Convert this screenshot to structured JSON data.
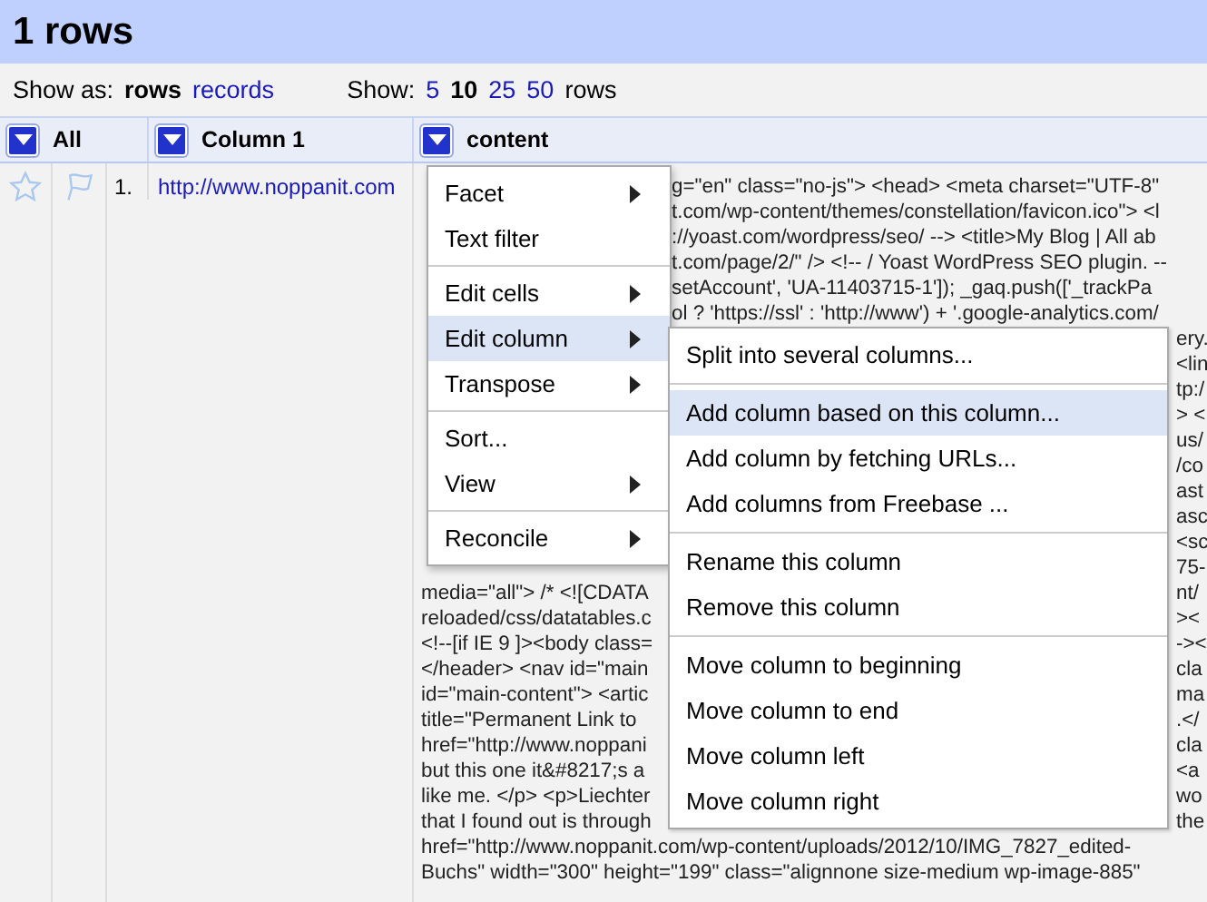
{
  "title": "1 rows",
  "toolbar": {
    "show_as_label": "Show as:",
    "show_as": [
      {
        "label": "rows",
        "selected": true
      },
      {
        "label": "records",
        "selected": false
      }
    ],
    "show_label": "Show:",
    "page_sizes": [
      {
        "label": "5",
        "selected": false
      },
      {
        "label": "10",
        "selected": true
      },
      {
        "label": "25",
        "selected": false
      },
      {
        "label": "50",
        "selected": false
      }
    ],
    "page_sizes_suffix": "rows"
  },
  "columns": [
    {
      "label": "All"
    },
    {
      "label": "Column 1"
    },
    {
      "label": "content"
    }
  ],
  "row": {
    "index": "1.",
    "starred": false,
    "flagged": false,
    "url": "http://www.noppanit.com"
  },
  "content_lines": [
    {
      "kind": "beside_menu",
      "right": "g=\"en\" class=\"no-js\"> <head> <meta charset=\"UTF-8\""
    },
    {
      "kind": "beside_menu",
      "right": "t.com/wp-content/themes/constellation/favicon.ico\"> <l"
    },
    {
      "kind": "beside_menu",
      "right": "://yoast.com/wordpress/seo/ --> <title>My Blog | All ab"
    },
    {
      "kind": "beside_menu",
      "right": "t.com/page/2/\" /> <!-- / Yoast WordPress SEO plugin. --"
    },
    {
      "kind": "beside_menu",
      "right": "setAccount', 'UA-11403715-1']); _gaq.push(['_trackPa"
    },
    {
      "kind": "beside_menu",
      "right": "ol ? 'https://ssl' : 'http://www') + '.google-analytics.com/"
    },
    {
      "kind": "beside_submenu",
      "right": "ery."
    },
    {
      "kind": "beside_submenu",
      "right": "<lin"
    },
    {
      "kind": "beside_submenu",
      "right": "tp:/"
    },
    {
      "kind": "beside_submenu",
      "right": "> <"
    },
    {
      "kind": "beside_submenu",
      "right": "us/"
    },
    {
      "kind": "beside_submenu",
      "right": "/co"
    },
    {
      "kind": "beside_submenu",
      "right": "ast"
    },
    {
      "kind": "beside_submenu",
      "right": "asc"
    },
    {
      "kind": "beside_submenu",
      "right": "<sc"
    },
    {
      "kind": "beside_submenu",
      "right": "75-"
    },
    {
      "kind": "beside_submenu",
      "left": "media=\"all\"> /* <![CDATA",
      "right": "nt/"
    },
    {
      "kind": "beside_submenu",
      "left": "reloaded/css/datatables.c",
      "right": "><"
    },
    {
      "kind": "beside_submenu",
      "left": "<!--[if IE 9 ]><body class=",
      "right": "-><"
    },
    {
      "kind": "beside_submenu",
      "left": "</header> <nav id=\"main",
      "right": "cla"
    },
    {
      "kind": "beside_submenu",
      "left": "id=\"main-content\"> <artic",
      "right": "ma"
    },
    {
      "kind": "beside_submenu",
      "left": "title=\"Permanent Link to",
      "right": ".</"
    },
    {
      "kind": "beside_submenu",
      "left": "href=\"http://www.noppani",
      "right": "cla"
    },
    {
      "kind": "beside_submenu",
      "left": "but this one it&#8217;s a",
      "right": "<a"
    },
    {
      "kind": "beside_submenu",
      "left": "like me. </p> <p>Liechter",
      "right": "wo"
    },
    {
      "kind": "beside_submenu",
      "left": "that I found out is through",
      "right": "the"
    },
    {
      "kind": "full",
      "left": "href=\"http://www.noppanit.com/wp-content/uploads/2012/10/IMG_7827_edited-"
    },
    {
      "kind": "full",
      "left": "Buchs\" width=\"300\" height=\"199\" class=\"alignnone size-medium wp-image-885\""
    }
  ],
  "menu": [
    [
      {
        "label": "Facet",
        "submenu": true,
        "selected": false
      },
      {
        "label": "Text filter",
        "submenu": false,
        "selected": false
      }
    ],
    [
      {
        "label": "Edit cells",
        "submenu": true,
        "selected": false
      },
      {
        "label": "Edit column",
        "submenu": true,
        "selected": true
      },
      {
        "label": "Transpose",
        "submenu": true,
        "selected": false
      }
    ],
    [
      {
        "label": "Sort...",
        "submenu": false,
        "selected": false
      },
      {
        "label": "View",
        "submenu": true,
        "selected": false
      }
    ],
    [
      {
        "label": "Reconcile",
        "submenu": true,
        "selected": false
      }
    ]
  ],
  "submenu": [
    [
      {
        "label": "Split into several columns...",
        "selected": false
      }
    ],
    [
      {
        "label": "Add column based on this column...",
        "selected": true
      },
      {
        "label": "Add column by fetching URLs...",
        "selected": false
      },
      {
        "label": "Add columns from Freebase ...",
        "selected": false
      }
    ],
    [
      {
        "label": "Rename this column",
        "selected": false
      },
      {
        "label": "Remove this column",
        "selected": false
      }
    ],
    [
      {
        "label": "Move column to beginning",
        "selected": false
      },
      {
        "label": "Move column to end",
        "selected": false
      },
      {
        "label": "Move column left",
        "selected": false
      },
      {
        "label": "Move column right",
        "selected": false
      }
    ]
  ]
}
